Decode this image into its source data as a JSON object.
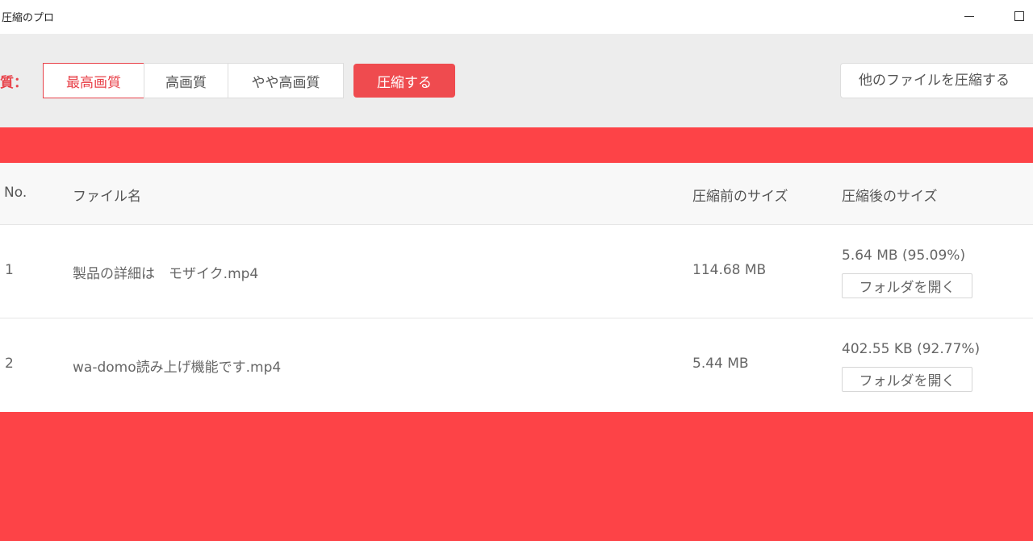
{
  "window": {
    "title": "圧縮のプロ"
  },
  "toolbar": {
    "quality_label": "質：",
    "quality_options": [
      "最高画質",
      "高画質",
      "やや高画質"
    ],
    "selected_quality": "最高画質",
    "compress_label": "圧縮する",
    "other_files_label": "他のファイルを圧縮する"
  },
  "table": {
    "headers": {
      "no": "No.",
      "name": "ファイル名",
      "before": "圧縮前のサイズ",
      "after": "圧縮後のサイズ"
    },
    "rows": [
      {
        "no": "1",
        "name": "製品の詳細は　モザイク.mp4",
        "before": "114.68 MB",
        "after": "5.64 MB (95.09%)",
        "open_folder": "フォルダを開く"
      },
      {
        "no": "2",
        "name": "wa-domo読み上げ機能です.mp4",
        "before": "5.44 MB",
        "after": "402.55 KB (92.77%)",
        "open_folder": "フォルダを開く"
      }
    ]
  },
  "colors": {
    "accent": "#fd4347",
    "button_red": "#ef4b4f",
    "toolbar_bg": "#ededed"
  },
  "icons": {
    "minimize": "minimize-icon",
    "maximize": "maximize-icon"
  }
}
